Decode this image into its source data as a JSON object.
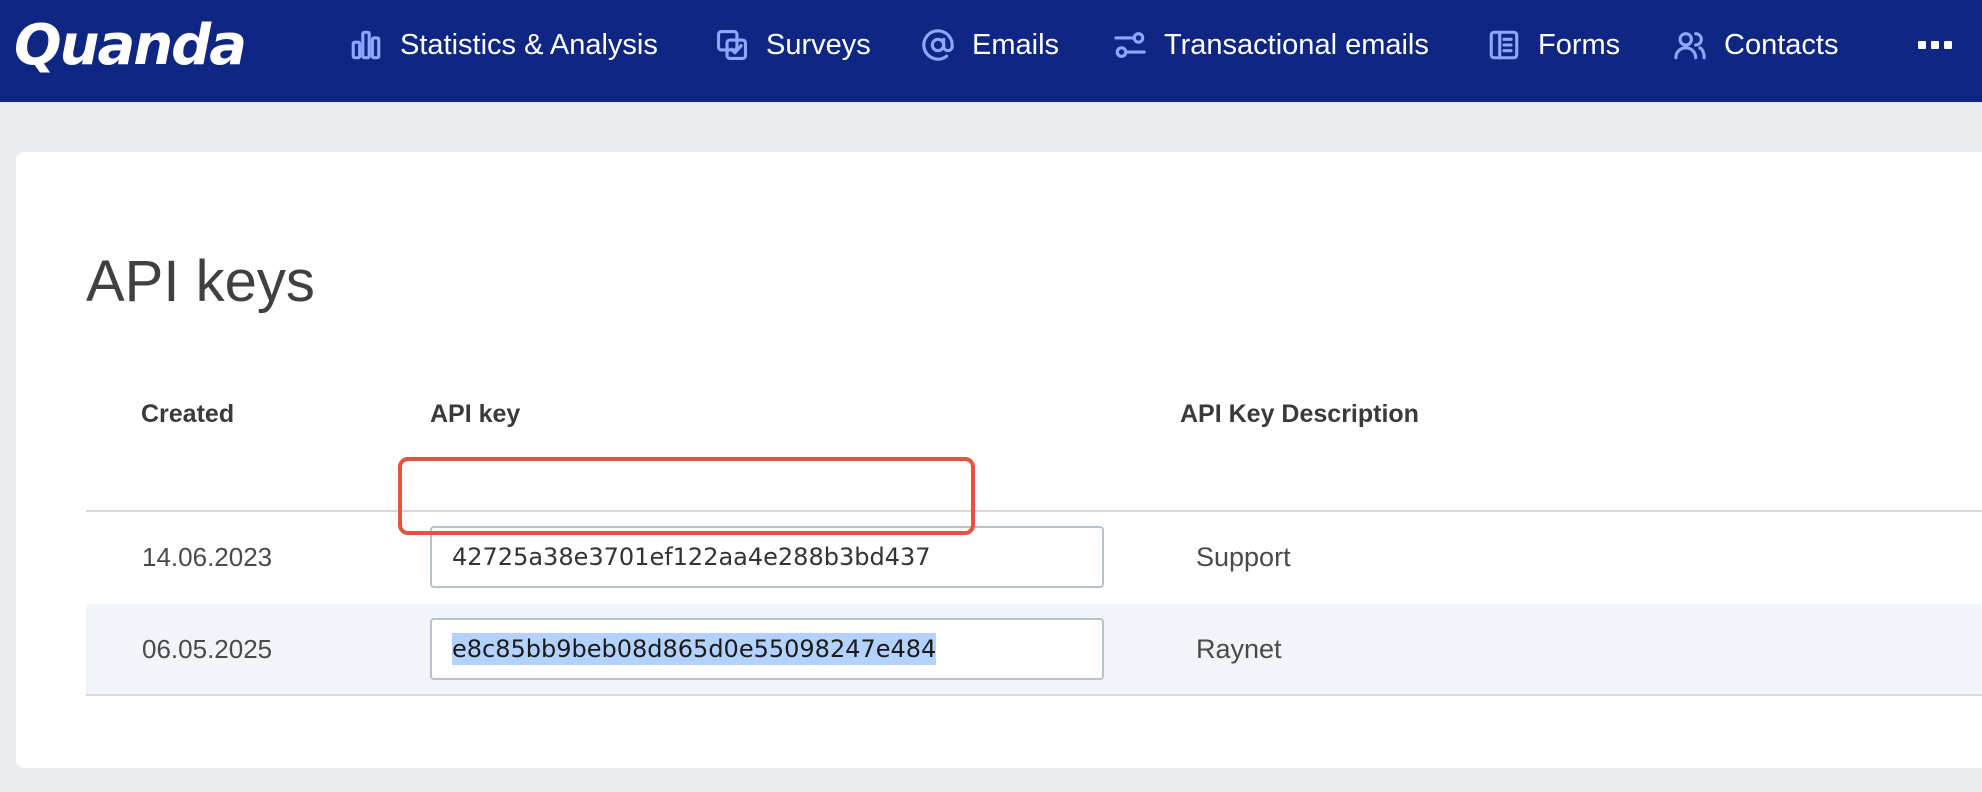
{
  "app": {
    "logo_text": "Quanda"
  },
  "nav": {
    "items": [
      {
        "label": "Statistics & Analysis",
        "icon": "bar-chart-icon"
      },
      {
        "label": "Surveys",
        "icon": "survey-checkbox-icon"
      },
      {
        "label": "Emails",
        "icon": "at-sign-icon"
      },
      {
        "label": "Transactional emails",
        "icon": "transactional-sliders-icon"
      },
      {
        "label": "Forms",
        "icon": "form-document-icon"
      },
      {
        "label": "Contacts",
        "icon": "contacts-people-icon"
      }
    ],
    "more_icon": "more-dots-icon"
  },
  "page": {
    "title": "API keys"
  },
  "table": {
    "headers": {
      "created": "Created",
      "api_key": "API key",
      "description": "API Key Description"
    },
    "rows": [
      {
        "created": "14.06.2023",
        "api_key": "42725a38e3701ef122aa4e288b3bd437",
        "description": "Support",
        "selected": false
      },
      {
        "created": "06.05.2025",
        "api_key": "e8c85bb9beb08d865d0e55098247e484",
        "description": "Raynet",
        "selected": true
      }
    ]
  },
  "colors": {
    "topbar": "#102683",
    "nav_icon": "#8fa7ff",
    "selection": "#b4d2ff",
    "highlight": "#e5533f"
  }
}
